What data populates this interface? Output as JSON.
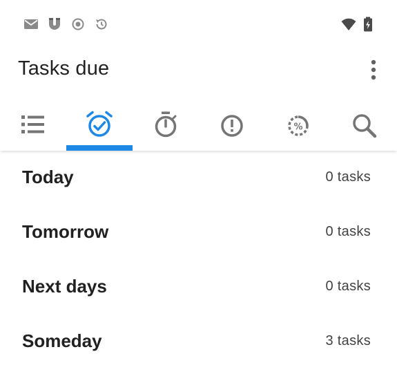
{
  "status_bar": {
    "left_icons": [
      "mail-icon",
      "magnet-icon",
      "record-icon",
      "sync-icon"
    ],
    "right_icons": [
      "wifi-icon",
      "battery-charging-icon"
    ]
  },
  "app_bar": {
    "title": "Tasks due",
    "overflow_icon": "more-vert-icon"
  },
  "tabs": [
    {
      "icon": "list-icon",
      "selected": false
    },
    {
      "icon": "alarm-check-icon",
      "selected": true
    },
    {
      "icon": "timer-icon",
      "selected": false
    },
    {
      "icon": "priority-icon",
      "selected": false
    },
    {
      "icon": "progress-percent-icon",
      "selected": false
    },
    {
      "icon": "search-icon",
      "selected": false
    }
  ],
  "colors": {
    "accent": "#1e88e5",
    "icon_gray": "#757575",
    "text_primary": "#212121"
  },
  "groups": [
    {
      "label": "Today",
      "count": "0 tasks"
    },
    {
      "label": "Tomorrow",
      "count": "0 tasks"
    },
    {
      "label": "Next days",
      "count": "0 tasks"
    },
    {
      "label": "Someday",
      "count": "3 tasks"
    }
  ]
}
